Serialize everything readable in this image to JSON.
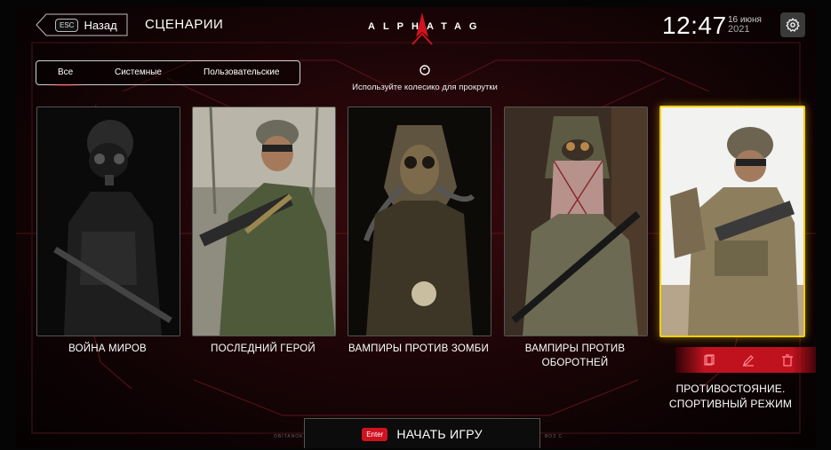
{
  "header": {
    "esc_key": "ESC",
    "back_label": "Назад",
    "title": "СЦЕНАРИИ",
    "logo_text": "ALPHATAG",
    "time": "12:47",
    "date_line1": "16 июня",
    "date_line2": "2021",
    "settings_icon": "gear-icon"
  },
  "filters": {
    "tabs": [
      "Все",
      "Системные",
      "Пользовательские"
    ],
    "active": "Все"
  },
  "scroll_hint": {
    "icon": "mouse-wheel-icon",
    "text": "Используйте колесико для прокрутки"
  },
  "scenarios": [
    {
      "title": "ВОЙНА МИРОВ",
      "art": "gasmask-soldier"
    },
    {
      "title": "ПОСЛЕДНИЙ ГЕРОЙ",
      "art": "machine-gunner"
    },
    {
      "title": "ВАМПИРЫ ПРОТИВ ЗОМБИ",
      "art": "hooded-gasmask"
    },
    {
      "title_line1": "ВАМПИРЫ ПРОТИВ",
      "title_line2": "ОБОРОТНЕЙ",
      "art": "shemagh-fighter"
    },
    {
      "title_line1": "ПРОТИВОСТОЯНИЕ.",
      "title_line2": "СПОРТИВНЫЙ РЕЖИМ",
      "art": "spec-ops",
      "selected": true
    }
  ],
  "card_actions": [
    "copy-icon",
    "edit-icon",
    "delete-icon"
  ],
  "start": {
    "key": "Enter",
    "label": "НАЧАТЬ ИГРУ"
  },
  "footer": {
    "left_tiny": "OBITANOK",
    "right_tiny": "ВОЗ С"
  },
  "colors": {
    "accent_red": "#d0121f",
    "selected_border": "#f4d000",
    "background": "#1d0507"
  }
}
